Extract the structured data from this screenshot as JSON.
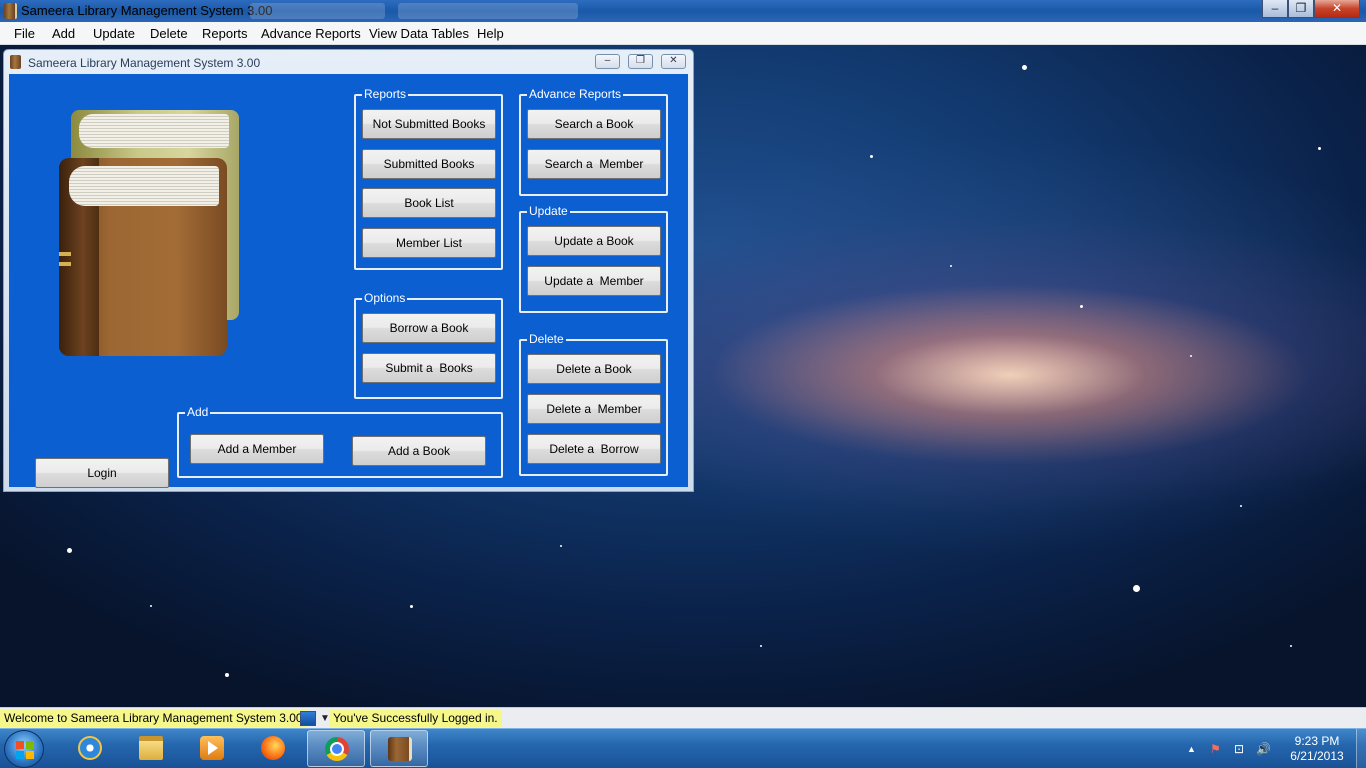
{
  "app": {
    "title": "Sameera Library Management System 3.00"
  },
  "window_controls": {
    "minimize": "–",
    "restore": "❐",
    "close": "✕"
  },
  "menu": [
    "File",
    "Add",
    "Update",
    "Delete",
    "Reports",
    "Advance Reports",
    "View Data Tables",
    "Help"
  ],
  "child_window": {
    "title": "Sameera Library Management System 3.00",
    "groups": {
      "reports": {
        "label": "Reports",
        "buttons": [
          "Not Submitted Books",
          "Submitted Books",
          "Book List",
          "Member List"
        ]
      },
      "options": {
        "label": "Options",
        "buttons": [
          "Borrow a Book",
          "Submit a  Books"
        ]
      },
      "add": {
        "label": "Add",
        "buttons": [
          "Add a Member",
          "Add a Book"
        ]
      },
      "advance_reports": {
        "label": "Advance Reports",
        "buttons": [
          "Search a Book",
          "Search a  Member"
        ]
      },
      "update": {
        "label": "Update",
        "buttons": [
          "Update a Book",
          "Update a  Member"
        ]
      },
      "delete": {
        "label": "Delete",
        "buttons": [
          "Delete a Book",
          "Delete a  Member",
          "Delete a  Borrow"
        ]
      }
    },
    "login_button": "Login"
  },
  "status_bar": {
    "welcome": "Welcome to Sameera Library Management System 3.00",
    "message": "You've Successfully Logged in."
  },
  "taskbar": {
    "apps": [
      "internet-explorer-icon",
      "windows-explorer-icon",
      "media-player-icon",
      "firefox-icon",
      "chrome-icon",
      "library-app-icon"
    ],
    "clock": {
      "time": "9:23 PM",
      "date": "6/21/2013"
    },
    "tray": {
      "show_hidden": "▲",
      "flag": "⚑",
      "network": "⊡",
      "volume": "🔊"
    }
  },
  "colors": {
    "child_client_bg": "#0b5fd1",
    "status_highlight": "#f5f78a",
    "taskbar": "#2567ae"
  }
}
